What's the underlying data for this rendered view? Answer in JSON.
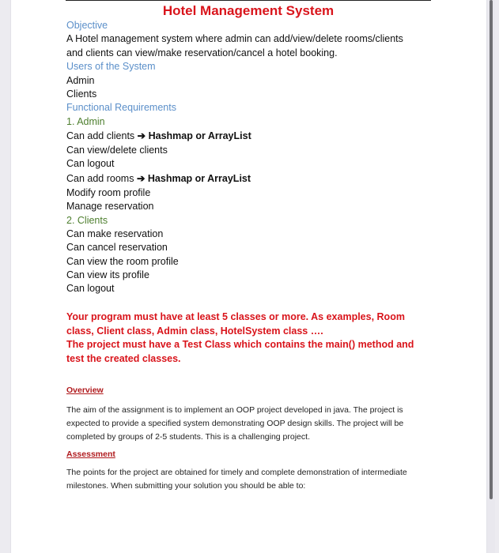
{
  "document": {
    "title": "Hotel Management System",
    "objective_heading": "Objective",
    "objective_text_1": "A Hotel management system where admin can add/view/delete rooms/clients",
    "objective_text_2": "and clients can view/make reservation/cancel a hotel booking.",
    "users_heading": "Users of the System",
    "users": [
      "Admin",
      "Clients"
    ],
    "functional_heading": "Functional Requirements",
    "admin_heading": "1. Admin",
    "admin_items": [
      {
        "text": "Can add clients ",
        "arrow": "➔",
        "bold": " Hashmap or ArrayList"
      },
      {
        "text": "Can view/delete clients"
      },
      {
        "text": "Can logout"
      },
      {
        "text": "Can add rooms ",
        "arrow": "➔",
        "bold": " Hashmap or ArrayList"
      },
      {
        "text": "Modify room profile"
      },
      {
        "text": "Manage reservation"
      }
    ],
    "clients_heading": "2. Clients",
    "client_items": [
      "Can make reservation",
      "Can cancel reservation",
      "Can view the room profile",
      "Can view its profile",
      "Can logout"
    ],
    "requirement_note_1": "Your program must have at least 5 classes or more. As examples, Room class, Client class, Admin class, HotelSystem class ….",
    "requirement_note_2": "The project must have a Test Class which contains the main() method and test the created classes.",
    "overview_heading": "Overview",
    "overview_text": "The aim of the assignment is to implement an OOP project developed in java. The project is expected to provide a specified system demonstrating OOP design skills. The project will be completed by groups of 2-5 students. This is a challenging project.",
    "assessment_heading": "Assessment",
    "assessment_text": "The points for the project are obtained for timely and complete demonstration of intermediate milestones. When submitting your solution you should be able to:"
  },
  "colors": {
    "title_red": "#d9141b",
    "heading_blue": "#5b8fc9",
    "subheading_green": "#4e7f2f",
    "section_red": "#b01a1d"
  }
}
